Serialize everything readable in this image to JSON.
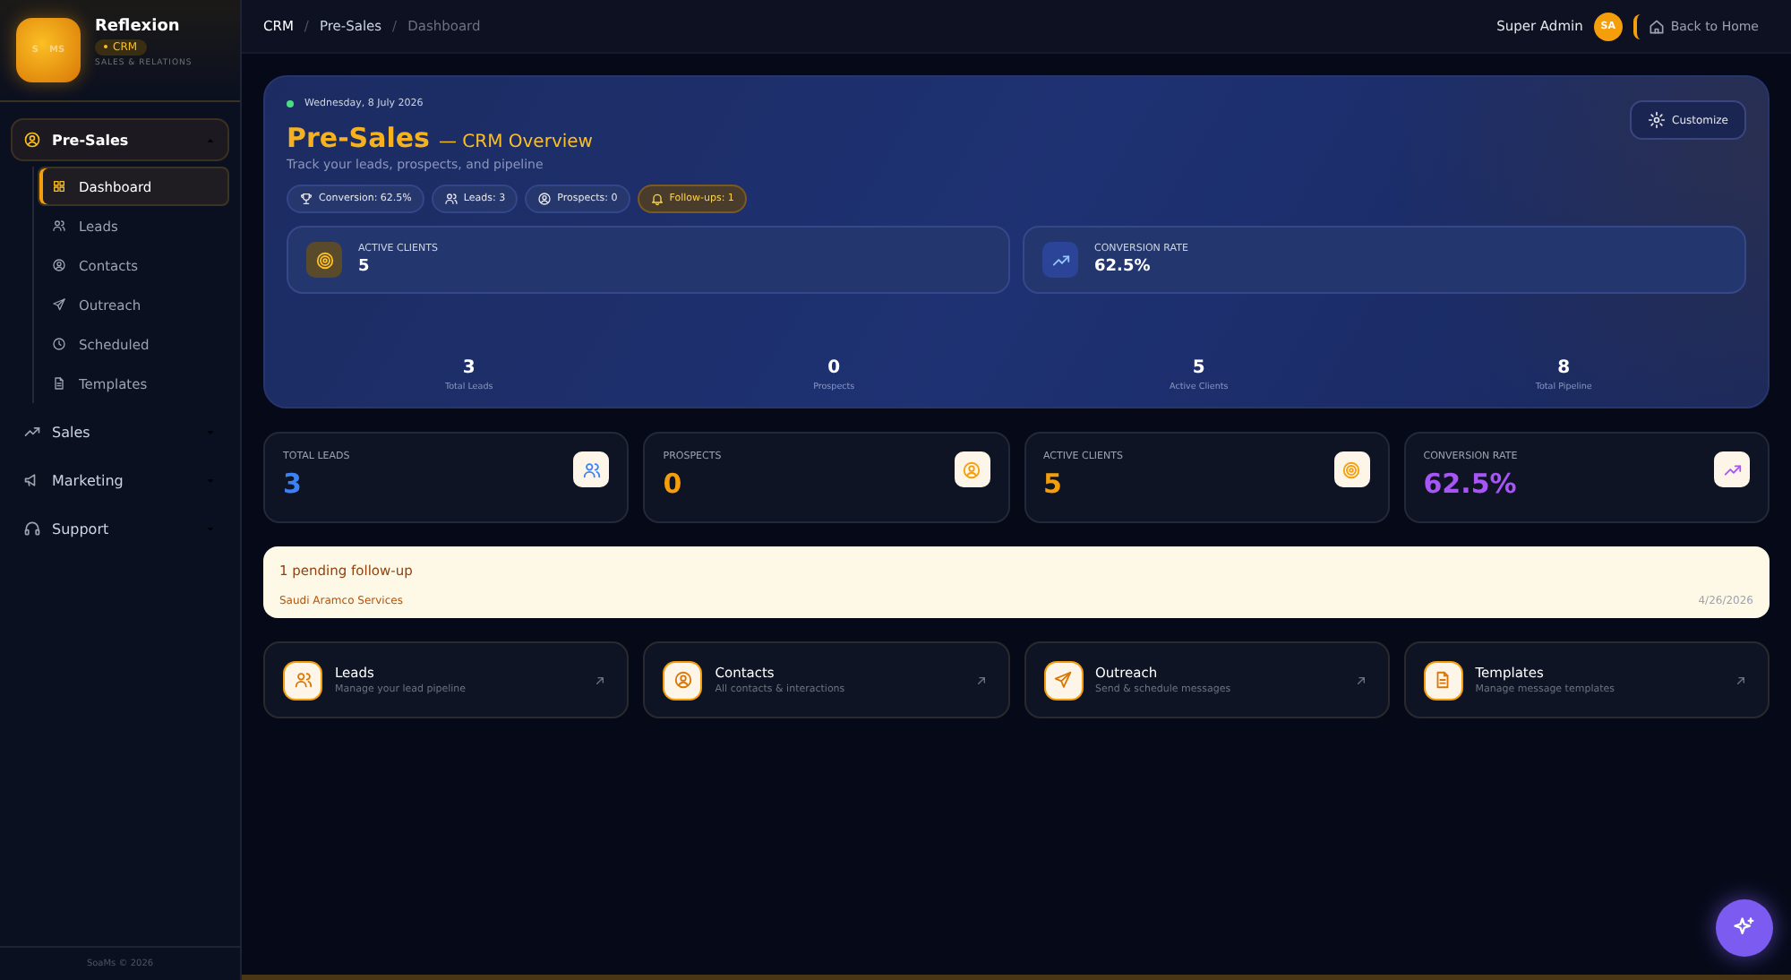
{
  "brand": {
    "name": "Reflexion",
    "badge": "CRM",
    "tagline": "SALES & RELATIONS",
    "logo_left": "S",
    "logo_right": "MS"
  },
  "sidebar": {
    "items": [
      {
        "label": "Pre-Sales",
        "expanded": true,
        "children": [
          {
            "label": "Dashboard",
            "selected": true
          },
          {
            "label": "Leads",
            "selected": false
          },
          {
            "label": "Contacts",
            "selected": false
          },
          {
            "label": "Outreach",
            "selected": false
          },
          {
            "label": "Scheduled",
            "selected": false
          },
          {
            "label": "Templates",
            "selected": false
          }
        ]
      },
      {
        "label": "Sales",
        "expanded": false
      },
      {
        "label": "Marketing",
        "expanded": false
      },
      {
        "label": "Support",
        "expanded": false
      }
    ],
    "footer": "SoaMs © 2026"
  },
  "breadcrumb": [
    "CRM",
    "Pre-Sales",
    "Dashboard"
  ],
  "breadcrumb_separator": "/",
  "user": {
    "name": "Super Admin",
    "initials": "SA"
  },
  "back_link": "Back to Home",
  "hero": {
    "date": "Wednesday, 8 July 2026",
    "title": "Pre-Sales",
    "subtitle": "— CRM Overview",
    "description": "Track your leads, prospects, and pipeline",
    "customize": "Customize",
    "chips": [
      {
        "label": "Conversion: 62.5%",
        "highlight": false
      },
      {
        "label": "Leads: 3",
        "highlight": false
      },
      {
        "label": "Prospects: 0",
        "highlight": false
      },
      {
        "label": "Follow-ups: 1",
        "highlight": true
      }
    ],
    "highlights": [
      {
        "label": "ACTIVE CLIENTS",
        "value": "5"
      },
      {
        "label": "CONVERSION RATE",
        "value": "62.5%"
      }
    ],
    "totals": [
      {
        "value": "3",
        "label": "Total Leads"
      },
      {
        "value": "0",
        "label": "Prospects"
      },
      {
        "value": "5",
        "label": "Active Clients"
      },
      {
        "value": "8",
        "label": "Total Pipeline"
      }
    ]
  },
  "stats": [
    {
      "label": "TOTAL LEADS",
      "value": "3",
      "color": "#3b82f6"
    },
    {
      "label": "PROSPECTS",
      "value": "0",
      "color": "#f59e0b"
    },
    {
      "label": "ACTIVE CLIENTS",
      "value": "5",
      "color": "#f59e0b"
    },
    {
      "label": "CONVERSION RATE",
      "value": "62.5%",
      "color": "#a855f7"
    }
  ],
  "followup": {
    "title": "1 pending follow-up",
    "company": "Saudi Aramco Services",
    "date": "4/26/2026"
  },
  "quick_links": [
    {
      "title": "Leads",
      "description": "Manage your lead pipeline"
    },
    {
      "title": "Contacts",
      "description": "All contacts & interactions"
    },
    {
      "title": "Outreach",
      "description": "Send & schedule messages"
    },
    {
      "title": "Templates",
      "description": "Manage message templates"
    }
  ]
}
